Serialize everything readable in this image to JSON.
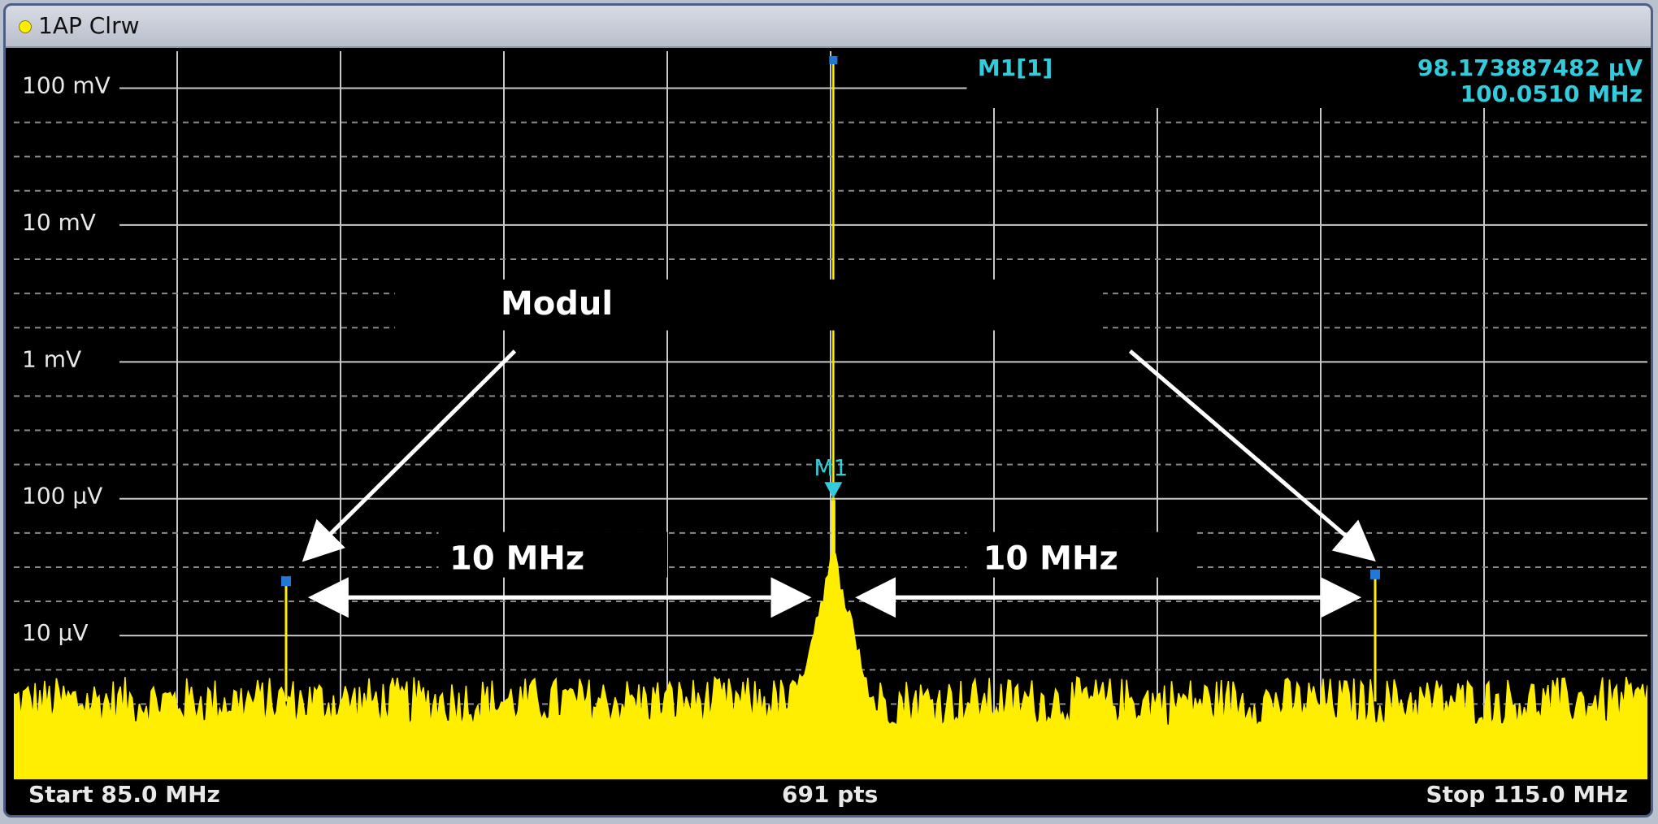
{
  "window": {
    "trace_label": "1AP Clrw"
  },
  "marker": {
    "name": "M1[1]",
    "value": "98.173887482 µV",
    "freq": "100.0510 MHz",
    "label": "M1"
  },
  "footer": {
    "start": "Start 85.0 MHz",
    "points": "691 pts",
    "stop": "Stop 115.0 MHz"
  },
  "annotations": {
    "modul": "Modul",
    "span_left": "10 MHz",
    "span_right": "10 MHz"
  },
  "colors": {
    "trace": "#ffee00",
    "marker": "#33ccdd",
    "grid": "#c8c8c8",
    "background": "#000000",
    "annotation": "#ffffff"
  },
  "chart_data": {
    "type": "line",
    "title": "",
    "xlabel": "",
    "ylabel": "",
    "xlim": [
      85.0,
      115.0
    ],
    "ylim_decades": [
      -6.05,
      -0.73
    ],
    "y_scale": "log",
    "grid": true,
    "ytick_labels": [
      "100 mV",
      "10 mV",
      "1 mV",
      "100 µV",
      "10 µV"
    ],
    "ytick_values": [
      0.1,
      0.01,
      0.001,
      0.0001,
      1e-05
    ],
    "noise_floor_volts": 3.3e-06,
    "peaks": [
      {
        "freq_mhz": 100.05,
        "volts": 9.8e-05
      },
      {
        "freq_mhz": 90.0,
        "volts": 2.5e-05
      },
      {
        "freq_mhz": 110.0,
        "volts": 2.8e-05
      }
    ],
    "points": 691
  }
}
